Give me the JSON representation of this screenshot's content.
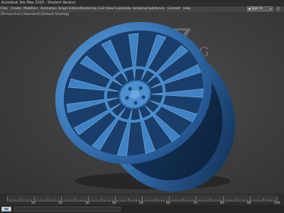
{
  "window": {
    "title": "Autodesk 3ds Max 2020 - Student Version"
  },
  "menubar": {
    "items": [
      "Files",
      "Create",
      "Modifiers",
      "Animation",
      "Graph Editors",
      "Rendering",
      "Civil View",
      "Customize",
      "Scripting",
      "Substance",
      "Content",
      "Help"
    ],
    "signin_label": "Sign In",
    "help_label": "?"
  },
  "viewport": {
    "label": "[Perspective] [Standard] [Default Shading]",
    "scene": "blue multi-spoke alloy wheel rim",
    "watermark": "ZG",
    "colors": {
      "rim": "#3f7fc0",
      "rim_dark": "#1d3f6a",
      "background": "#3b3b3b"
    }
  },
  "timeline": {
    "labels": [
      "10",
      "20",
      "30",
      "40",
      "50",
      "60",
      "70",
      "80",
      "90",
      "100"
    ]
  },
  "statusbar": {
    "maxscript_icon": "maxscript-listener-icon"
  }
}
